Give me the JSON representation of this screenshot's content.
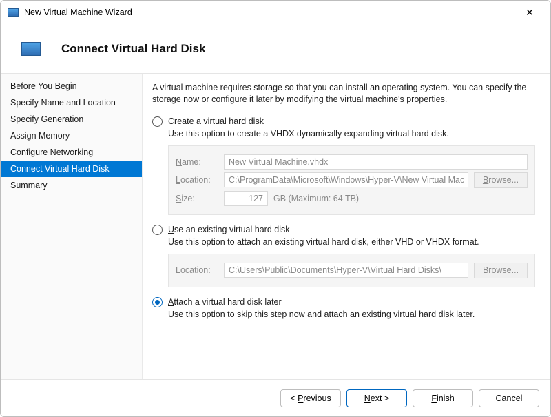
{
  "window": {
    "title": "New Virtual Machine Wizard",
    "close_glyph": "✕"
  },
  "header": {
    "title": "Connect Virtual Hard Disk"
  },
  "sidebar": {
    "items": [
      {
        "label": "Before You Begin"
      },
      {
        "label": "Specify Name and Location"
      },
      {
        "label": "Specify Generation"
      },
      {
        "label": "Assign Memory"
      },
      {
        "label": "Configure Networking"
      },
      {
        "label": "Connect Virtual Hard Disk"
      },
      {
        "label": "Summary"
      }
    ],
    "selected_index": 5
  },
  "intro": "A virtual machine requires storage so that you can install an operating system. You can specify the storage now or configure it later by modifying the virtual machine's properties.",
  "options": {
    "selected": "later",
    "create": {
      "label": "Create a virtual hard disk",
      "label_ul": "C",
      "desc": "Use this option to create a VHDX dynamically expanding virtual hard disk.",
      "name_lbl_ul": "N",
      "name_lbl_rest": "ame:",
      "name_value": "New Virtual Machine.vhdx",
      "loc_lbl_ul": "L",
      "loc_lbl_rest": "ocation:",
      "loc_value": "C:\\ProgramData\\Microsoft\\Windows\\Hyper-V\\New Virtual Machine\\V",
      "browse_ul": "B",
      "browse_rest": "rowse...",
      "size_lbl_ul": "S",
      "size_lbl_rest": "ize:",
      "size_value": "127",
      "size_unit": "GB (Maximum: 64 TB)"
    },
    "existing": {
      "label": "Use an existing virtual hard disk",
      "label_ul": "U",
      "desc": "Use this option to attach an existing virtual hard disk, either VHD or VHDX format.",
      "loc_lbl_ul": "L",
      "loc_lbl_rest": "ocation:",
      "loc_value": "C:\\Users\\Public\\Documents\\Hyper-V\\Virtual Hard Disks\\",
      "browse_ul": "B",
      "browse_rest": "rowse..."
    },
    "later": {
      "label": "Attach a virtual hard disk later",
      "label_ul": "A",
      "desc": "Use this option to skip this step now and attach an existing virtual hard disk later."
    }
  },
  "footer": {
    "previous_pre": "< ",
    "previous_ul": "P",
    "previous_rest": "revious",
    "next_ul": "N",
    "next_rest": "ext >",
    "finish_ul": "F",
    "finish_rest": "inish",
    "cancel": "Cancel"
  }
}
